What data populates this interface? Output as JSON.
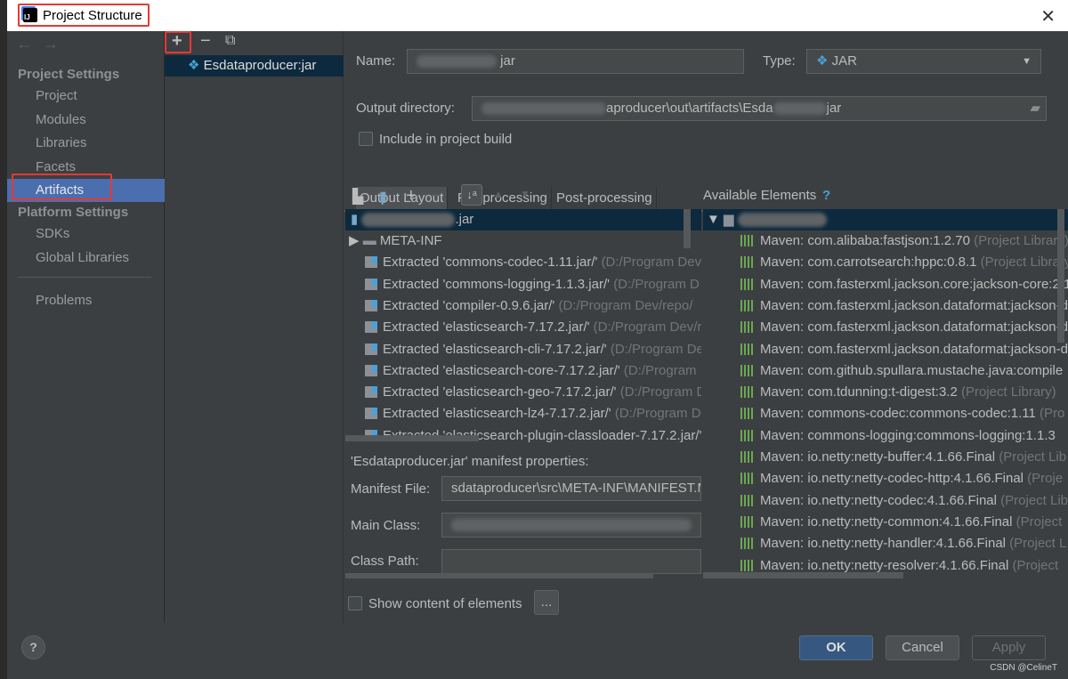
{
  "window": {
    "title": "Project Structure",
    "close": "✕"
  },
  "nav": {
    "back": "←",
    "forward": "→"
  },
  "sidebar": {
    "project_settings": "Project Settings",
    "items": [
      "Project",
      "Modules",
      "Libraries",
      "Facets",
      "Artifacts"
    ],
    "platform_settings": "Platform Settings",
    "platform_items": [
      "SDKs",
      "Global Libraries"
    ],
    "problems": "Problems",
    "selected": "Artifacts"
  },
  "artifact_list": {
    "toolbar": {
      "add": "+",
      "remove": "−",
      "copy": "⧉"
    },
    "items": [
      "Esdataproducer:jar"
    ]
  },
  "form": {
    "name_label": "Name:",
    "name_value": "jar",
    "type_label": "Type:",
    "type_value": "JAR",
    "output_label": "Output directory:",
    "output_value": "aproducer\\out\\artifacts\\Esda",
    "output_suffix": "jar",
    "include_label": "Include in project build",
    "include_checked": false
  },
  "tabs": [
    "Output Layout",
    "Pre-processing",
    "Post-processing"
  ],
  "layout_tree": {
    "root": ".jar",
    "items": [
      {
        "kind": "folder",
        "name": "META-INF",
        "path": ""
      },
      {
        "kind": "extracted",
        "name": "Extracted 'commons-codec-1.11.jar/'",
        "path": "(D:/Program Dev"
      },
      {
        "kind": "extracted",
        "name": "Extracted 'commons-logging-1.1.3.jar/'",
        "path": "(D:/Program D"
      },
      {
        "kind": "extracted",
        "name": "Extracted 'compiler-0.9.6.jar/'",
        "path": "(D:/Program Dev/repo/"
      },
      {
        "kind": "extracted",
        "name": "Extracted 'elasticsearch-7.17.2.jar/'",
        "path": "(D:/Program Dev/r"
      },
      {
        "kind": "extracted",
        "name": "Extracted 'elasticsearch-cli-7.17.2.jar/'",
        "path": "(D:/Program De"
      },
      {
        "kind": "extracted",
        "name": "Extracted 'elasticsearch-core-7.17.2.jar/'",
        "path": "(D:/Program"
      },
      {
        "kind": "extracted",
        "name": "Extracted 'elasticsearch-geo-7.17.2.jar/'",
        "path": "(D:/Program D"
      },
      {
        "kind": "extracted",
        "name": "Extracted 'elasticsearch-lz4-7.17.2.jar/'",
        "path": "(D:/Program D"
      },
      {
        "kind": "extracted",
        "name": "Extracted 'elasticsearch-plugin-classloader-7.17.2.jar/'",
        "path": ""
      }
    ]
  },
  "available": {
    "title": "Available Elements",
    "help": "?",
    "items": [
      {
        "name": "Maven: com.alibaba:fastjson:1.2.70",
        "suffix": "(Project Library)"
      },
      {
        "name": "Maven: com.carrotsearch:hppc:0.8.1",
        "suffix": "(Project Library)"
      },
      {
        "name": "Maven: com.fasterxml.jackson.core:jackson-core:2.1",
        "suffix": ""
      },
      {
        "name": "Maven: com.fasterxml.jackson.dataformat:jackson-d",
        "suffix": ""
      },
      {
        "name": "Maven: com.fasterxml.jackson.dataformat:jackson-d",
        "suffix": ""
      },
      {
        "name": "Maven: com.fasterxml.jackson.dataformat:jackson-d",
        "suffix": ""
      },
      {
        "name": "Maven: com.github.spullara.mustache.java:compile",
        "suffix": ""
      },
      {
        "name": "Maven: com.tdunning:t-digest:3.2",
        "suffix": "(Project Library)"
      },
      {
        "name": "Maven: commons-codec:commons-codec:1.11",
        "suffix": "(Pro"
      },
      {
        "name": "Maven: commons-logging:commons-logging:1.1.3",
        "suffix": ""
      },
      {
        "name": "Maven: io.netty:netty-buffer:4.1.66.Final",
        "suffix": "(Project Lib"
      },
      {
        "name": "Maven: io.netty:netty-codec-http:4.1.66.Final",
        "suffix": "(Proje"
      },
      {
        "name": "Maven: io.netty:netty-codec:4.1.66.Final",
        "suffix": "(Project Lib"
      },
      {
        "name": "Maven: io.netty:netty-common:4.1.66.Final",
        "suffix": "(Project"
      },
      {
        "name": "Maven: io.netty:netty-handler:4.1.66.Final",
        "suffix": "(Project L"
      },
      {
        "name": "Maven: io.netty:netty-resolver:4.1.66.Final",
        "suffix": "(Project"
      }
    ]
  },
  "manifest": {
    "title": "'Esdataproducer.jar' manifest properties:",
    "file_label": "Manifest File:",
    "file_value": "sdataproducer\\src\\META-INF\\MANIFEST.M",
    "main_label": "Main Class:",
    "main_value": "",
    "classpath_label": "Class Path:",
    "classpath_value": ""
  },
  "show_content": {
    "label": "Show content of elements",
    "checked": false,
    "browse": "..."
  },
  "buttons": {
    "help": "?",
    "ok": "OK",
    "cancel": "Cancel",
    "apply": "Apply"
  },
  "watermark": "CSDN @CelineT"
}
